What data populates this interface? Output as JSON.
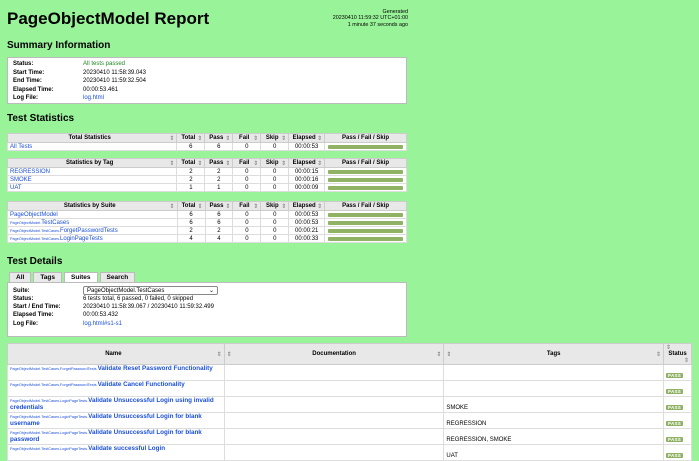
{
  "header": {
    "title": "PageObjectModel Report",
    "generated_label": "Generated",
    "generated_time": "20230410 11:59:32 UTC+01:00",
    "generated_ago": "1 minute 37 seconds ago"
  },
  "summary": {
    "heading": "Summary Information",
    "rows": [
      {
        "k": "Status:",
        "v": "All tests passed"
      },
      {
        "k": "Start Time:",
        "v": "20230410 11:58:39.043"
      },
      {
        "k": "End Time:",
        "v": "20230410 11:59:32.504"
      },
      {
        "k": "Elapsed Time:",
        "v": "00:00:53.461"
      },
      {
        "k": "Log File:",
        "v": "log.html"
      }
    ]
  },
  "stats": {
    "heading": "Test Statistics",
    "columns": [
      "Total",
      "Pass",
      "Fail",
      "Skip",
      "Elapsed",
      "Pass / Fail / Skip"
    ],
    "sort_glyph": "⇕",
    "total": {
      "title": "Total Statistics",
      "rows": [
        {
          "name": "All Tests",
          "total": "6",
          "pass": "6",
          "fail": "0",
          "skip": "0",
          "elapsed": "00:00:53"
        }
      ]
    },
    "tag": {
      "title": "Statistics by Tag",
      "rows": [
        {
          "name": "REGRESSION",
          "total": "2",
          "pass": "2",
          "fail": "0",
          "skip": "0",
          "elapsed": "00:00:15"
        },
        {
          "name": "SMOKE",
          "total": "2",
          "pass": "2",
          "fail": "0",
          "skip": "0",
          "elapsed": "00:00:16"
        },
        {
          "name": "UAT",
          "total": "1",
          "pass": "1",
          "fail": "0",
          "skip": "0",
          "elapsed": "00:00:09"
        }
      ]
    },
    "suite": {
      "title": "Statistics by Suite",
      "rows": [
        {
          "prefix": "",
          "name": "PageObjectModel",
          "total": "6",
          "pass": "6",
          "fail": "0",
          "skip": "0",
          "elapsed": "00:00:53"
        },
        {
          "prefix": "PageObjectModel.",
          "name": "TestCases",
          "total": "6",
          "pass": "6",
          "fail": "0",
          "skip": "0",
          "elapsed": "00:00:53"
        },
        {
          "prefix": "PageObjectModel.TestCases.",
          "name": "ForgetPasswordTests",
          "total": "2",
          "pass": "2",
          "fail": "0",
          "skip": "0",
          "elapsed": "00:00:21"
        },
        {
          "prefix": "PageObjectModel.TestCases.",
          "name": "LoginPageTests",
          "total": "4",
          "pass": "4",
          "fail": "0",
          "skip": "0",
          "elapsed": "00:00:33"
        }
      ]
    }
  },
  "details": {
    "heading": "Test Details",
    "tabs": [
      "All",
      "Tags",
      "Suites",
      "Search"
    ],
    "active_tab": "Suites",
    "suite_label": "Suite:",
    "suite_value": "PageObjectModel.TestCases",
    "rows": [
      {
        "k": "Status:",
        "v": "6 tests total, 6 passed, 0 failed, 0 skipped"
      },
      {
        "k": "Start / End Time:",
        "v": "20230410 11:58:39.067 / 20230410 11:59:32.499"
      },
      {
        "k": "Elapsed Time:",
        "v": "00:00:53.432"
      },
      {
        "k": "Log File:",
        "v": "log.html#s1-s1"
      }
    ]
  },
  "tests": {
    "columns": [
      "Name",
      "Documentation",
      "Tags",
      "Status"
    ],
    "pass_label": "PASS",
    "rows": [
      {
        "prefix": "PageObjectModel.TestCases.ForgetPasswordTests.",
        "name": "Validate Reset Password Functionality",
        "doc": "",
        "tags": ""
      },
      {
        "prefix": "PageObjectModel.TestCases.ForgetPasswordTests.",
        "name": "Validate Cancel Functionality",
        "doc": "",
        "tags": ""
      },
      {
        "prefix": "PageObjectModel.TestCases.LoginPageTests.",
        "name": "Validate Unsuccessful Login using invalid credentials",
        "doc": "",
        "tags": "SMOKE"
      },
      {
        "prefix": "PageObjectModel.TestCases.LoginPageTests.",
        "name": "Validate Unsuccessful Login for blank username",
        "doc": "",
        "tags": "REGRESSION"
      },
      {
        "prefix": "PageObjectModel.TestCases.LoginPageTests.",
        "name": "Validate Unsuccessful Login for blank password",
        "doc": "",
        "tags": "REGRESSION, SMOKE"
      },
      {
        "prefix": "PageObjectModel.TestCases.LoginPageTests.",
        "name": "Validate successful Login",
        "doc": "",
        "tags": "UAT"
      }
    ]
  }
}
